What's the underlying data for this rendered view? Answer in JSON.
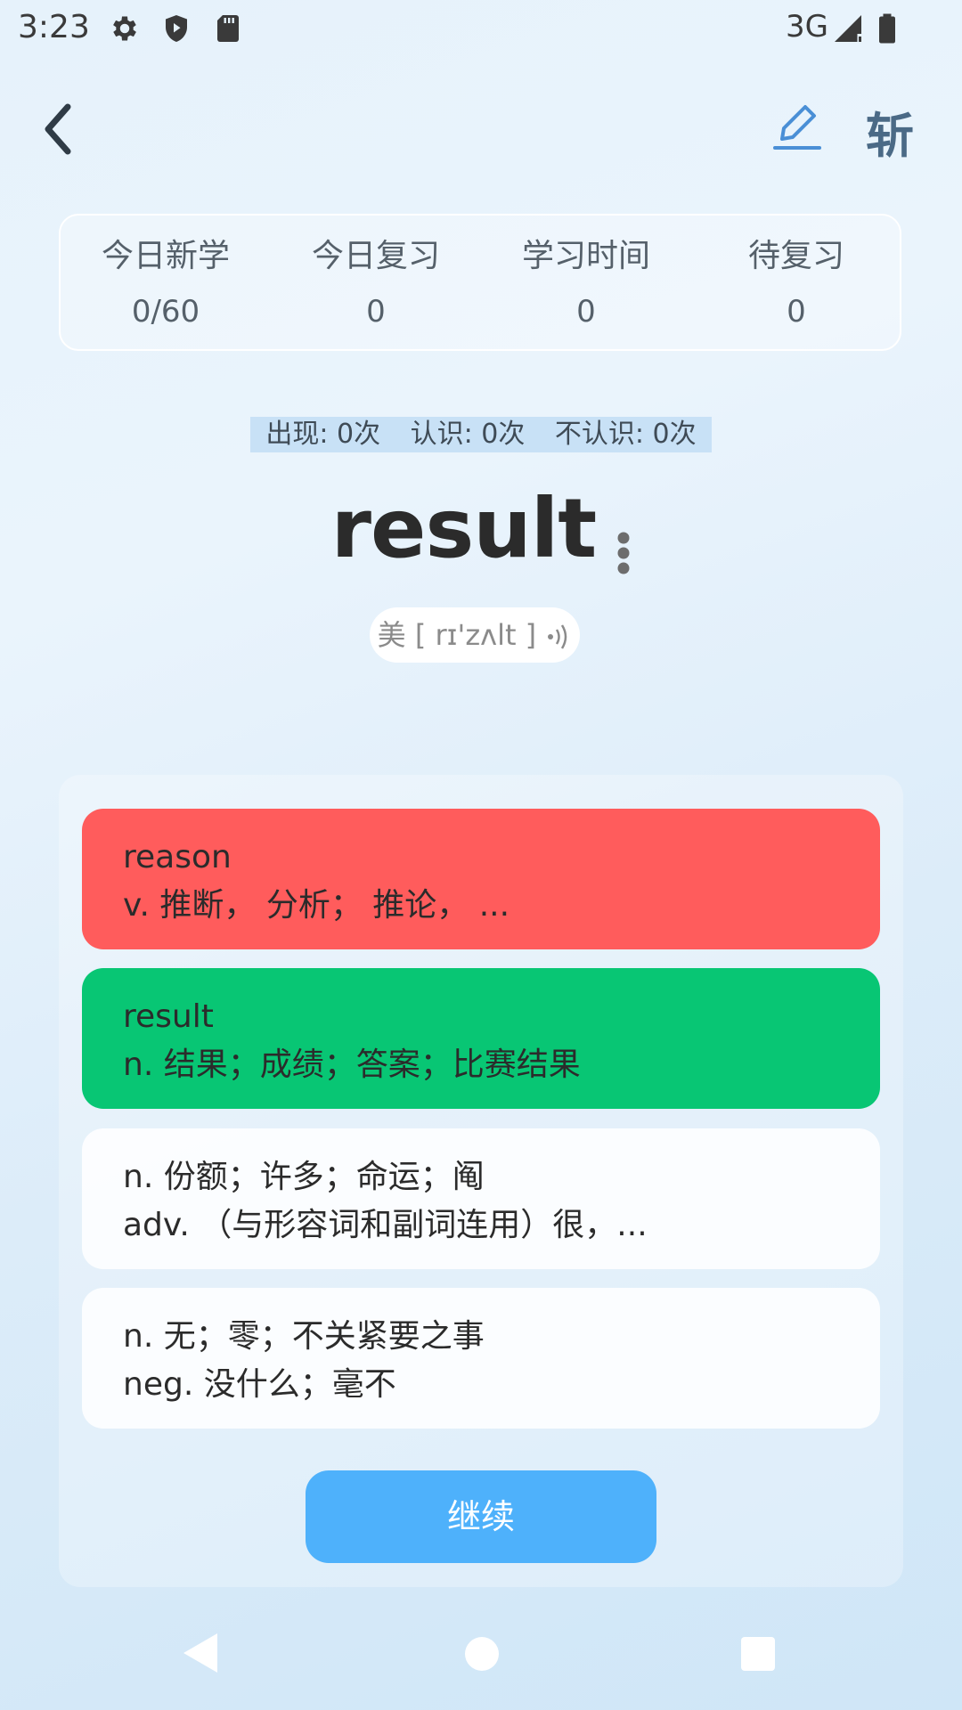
{
  "status_bar": {
    "time": "3:23",
    "network": "3G",
    "icons": [
      "gear-icon",
      "shield-icon",
      "sd-card-icon",
      "signal-icon",
      "battery-icon"
    ]
  },
  "header": {
    "edit_icon": "pencil-icon",
    "zhan_label": "斩"
  },
  "stats": [
    {
      "label": "今日新学",
      "value": "0/60"
    },
    {
      "label": "今日复习",
      "value": "0"
    },
    {
      "label": "学习时间",
      "value": "0"
    },
    {
      "label": "待复习",
      "value": "0"
    }
  ],
  "counters": {
    "appear": "出现: 0次",
    "known": "认识: 0次",
    "unknown": "不认识: 0次"
  },
  "word": {
    "text": "result",
    "phonetic": "美 [ rɪ'zʌlt ]"
  },
  "options": [
    {
      "line1": "reason",
      "line2": "v.   推断， 分析； 推论， ...",
      "state": "wrong"
    },
    {
      "line1": "result",
      "line2": "n.  结果；成绩；答案；比赛结果",
      "state": "correct"
    },
    {
      "line1": "n.  份额；许多；命运；阄",
      "line2": "adv.  （与形容词和副词连用）很，...",
      "state": "neutral"
    },
    {
      "line1": "n.  无；零；不关紧要之事",
      "line2": "neg.  没什么；毫不",
      "state": "neutral"
    }
  ],
  "continue_label": "继续",
  "colors": {
    "wrong": "#ff5c5c",
    "correct": "#08c674",
    "accent": "#4eb1fb"
  }
}
